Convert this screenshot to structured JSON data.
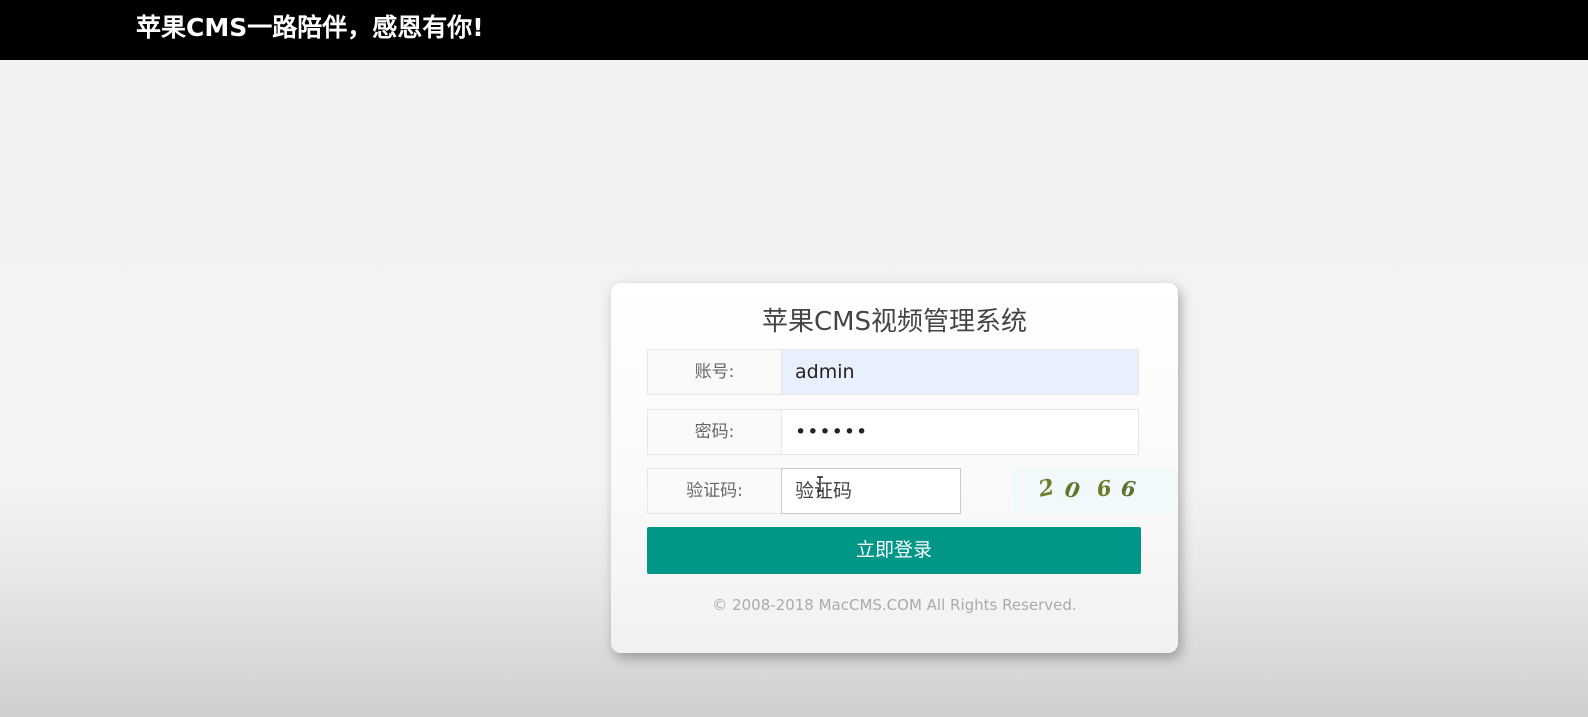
{
  "banner": {
    "text": "苹果CMS一路陪伴，感恩有你!"
  },
  "login": {
    "title": "苹果CMS视频管理系统",
    "username": {
      "label": "账号:",
      "value": "admin"
    },
    "password": {
      "label": "密码:",
      "value": "••••••"
    },
    "captcha": {
      "label": "验证码:",
      "placeholder": "验证码",
      "image_text": "2066"
    },
    "submit_label": "立即登录",
    "copyright": "© 2008-2018 MacCMS.COM All Rights Reserved."
  },
  "colors": {
    "banner_bg": "#000000",
    "primary_button": "#009688",
    "autofill_bg": "#e8f0fe"
  }
}
